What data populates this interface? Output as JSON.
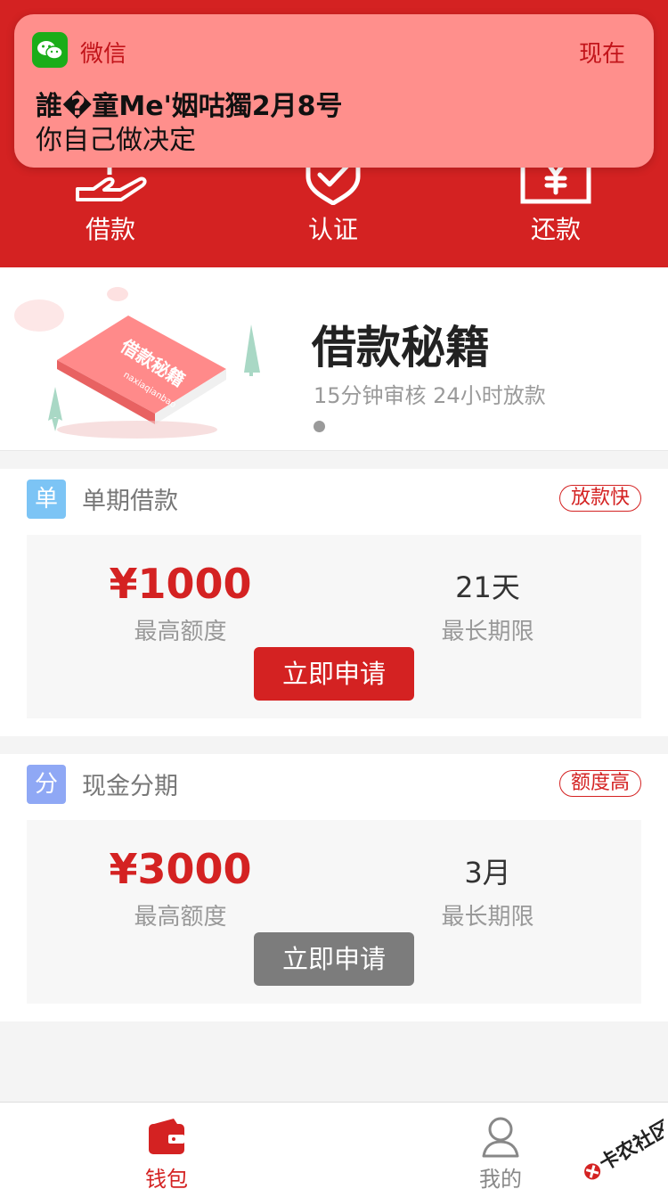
{
  "header": {
    "items": [
      {
        "label": "借款",
        "icon": "hand-loan-icon"
      },
      {
        "label": "认证",
        "icon": "shield-check-icon"
      },
      {
        "label": "还款",
        "icon": "yen-card-icon"
      }
    ]
  },
  "notification": {
    "app_name": "微信",
    "time": "现在",
    "title": "誰�童Me'姻咕獨2月8号",
    "message": "你自己做决定",
    "icon": "wechat-icon"
  },
  "banner": {
    "title": "借款秘籍",
    "subtitle": "15分钟审核 24小时放款",
    "book_title": "借款秘籍",
    "book_subtitle": "naxiaqianbao"
  },
  "products": [
    {
      "badge": "单",
      "badge_color": "#7cc4f5",
      "name": "单期借款",
      "tag": "放款快",
      "amount": "¥1000",
      "amount_label": "最高额度",
      "term": "21天",
      "term_label": "最长期限",
      "button": "立即申请",
      "button_color": "#d42222"
    },
    {
      "badge": "分",
      "badge_color": "#8fa8f5",
      "name": "现金分期",
      "tag": "额度高",
      "amount": "¥3000",
      "amount_label": "最高额度",
      "term": "3月",
      "term_label": "最长期限",
      "button": "立即申请",
      "button_color": "#7c7c7c"
    }
  ],
  "tabbar": {
    "items": [
      {
        "label": "钱包",
        "icon": "wallet-icon",
        "active": true
      },
      {
        "label": "我的",
        "icon": "user-icon",
        "active": false
      }
    ]
  },
  "watermark": {
    "text": "卡农社区"
  },
  "colors": {
    "brand_red": "#d42222",
    "notification_bg": "#ff8f8c",
    "inactive_gray": "#888888"
  }
}
